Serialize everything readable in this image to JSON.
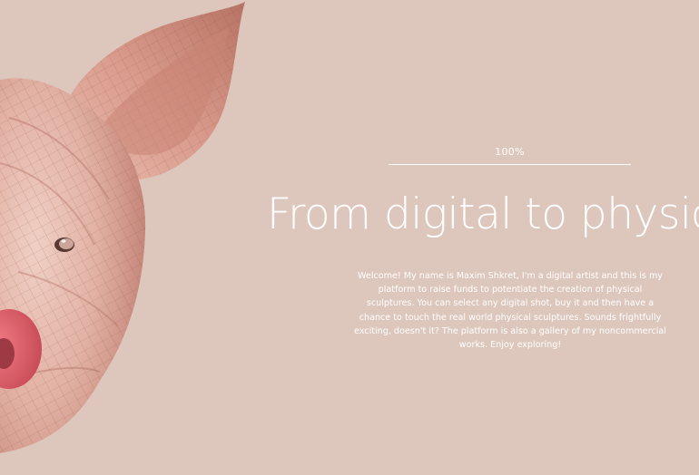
{
  "hero": {
    "progress_label": "100%",
    "progress_value": 1.0,
    "headline": "From digital to physical",
    "intro": "Welcome! My name is Maxim Shkret, I'm a digital artist and this is my platform to raise funds to potentiate the creation of physical sculptures. You can select any digital shot, buy it and then have a chance to touch the real world physical sculptures. Sounds frightfully exciting, doesn't it? The platform is also a gallery of my noncommercial works. Enjoy exploring!"
  },
  "colors": {
    "background": "#ddc7bd",
    "text": "#ffffff",
    "sculpture_skin": "#e4b3a6",
    "snout": "#e0606b"
  }
}
